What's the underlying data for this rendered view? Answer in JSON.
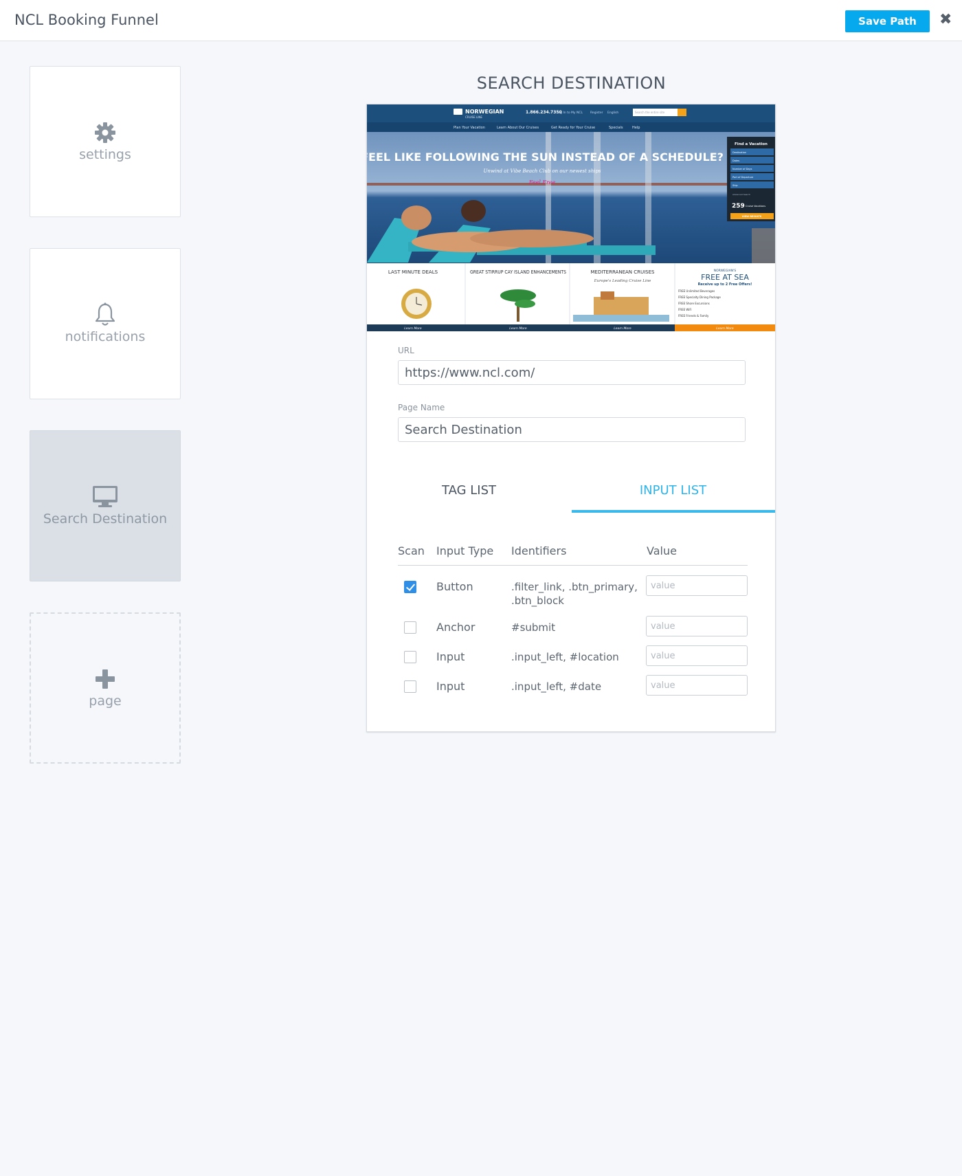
{
  "app": {
    "title": "NCL Booking Funnel",
    "save_label": "Save Path"
  },
  "sidebar": {
    "items": [
      {
        "label": "settings"
      },
      {
        "label": "notifications"
      },
      {
        "label": "Search Destination"
      },
      {
        "label": "page"
      }
    ]
  },
  "main": {
    "heading": "SEARCH DESTINATION",
    "url_label": "URL",
    "url_value": "https://www.ncl.com/",
    "page_name_label": "Page Name",
    "page_name_value": "Search Destination",
    "tabs": [
      {
        "label": "TAG LIST",
        "active": false
      },
      {
        "label": "INPUT LIST",
        "active": true
      }
    ],
    "table": {
      "headers": [
        "Scan",
        "Input Type",
        "Identifiers",
        "Value"
      ],
      "rows": [
        {
          "checked": true,
          "type": "Button",
          "identifiers_line1": ".filter_link, .btn_primary,",
          "identifiers_line2": ".btn_block",
          "placeholder": "value"
        },
        {
          "checked": false,
          "type": "Anchor",
          "identifiers_line1": "#submit",
          "identifiers_line2": "",
          "placeholder": "value"
        },
        {
          "checked": false,
          "type": "Input",
          "identifiers_line1": ".input_left, #location",
          "identifiers_line2": "",
          "placeholder": "value"
        },
        {
          "checked": false,
          "type": "Input",
          "identifiers_line1": ".input_left, #date",
          "identifiers_line2": "",
          "placeholder": "value"
        }
      ]
    }
  },
  "screenshot": {
    "phone": "1.866.234.7350",
    "nav_links": [
      "Log In to My NCL",
      "Register",
      "English",
      "Plan Your Vacation",
      "Learn About Our Cruises",
      "Get Ready for Your Cruise",
      "Specials",
      "Help"
    ],
    "search_placeholder": "Search the entire site",
    "logo_text": "NORWEGIAN",
    "logo_sub": "CRUISE LINE",
    "hero_title": "FEEL LIKE FOLLOWING THE SUN INSTEAD OF A SCHEDULE?",
    "hero_sub": "Unwind at Vibe Beach Club on our newest ships",
    "hero_script": "Feel Free",
    "finder": {
      "title": "Find a Vacation",
      "rows": [
        "Destination",
        "Dates",
        "Number of Days",
        "Port of Departure",
        "Ship"
      ],
      "advanced": "Advanced Search",
      "count": "259",
      "count_label": "Cruise Vacations",
      "button": "VIEW RESULTS"
    },
    "promos": [
      {
        "title": "LAST MINUTE DEALS",
        "sub": ""
      },
      {
        "title": "GREAT STIRRUP CAY ISLAND ENHANCEMENTS",
        "sub": ""
      },
      {
        "title": "MEDITERRANEAN CRUISES",
        "sub": "Europe's Leading Cruise Line"
      },
      {
        "title": "FREE AT SEA",
        "sub": "Receive up to 2 Free Offers!"
      }
    ],
    "promo_brand": "NORWEGIAN'S",
    "free_list": [
      "FREE Unlimited Beverages",
      "FREE Specialty Dining Package",
      "FREE Shore Excursions",
      "FREE WiFi",
      "FREE Friends & Family"
    ],
    "learn_more": "Learn More",
    "colors": {
      "nav": "#1d4f7d",
      "accent": "#f5a21b",
      "sea": "#2a5d8f"
    }
  }
}
